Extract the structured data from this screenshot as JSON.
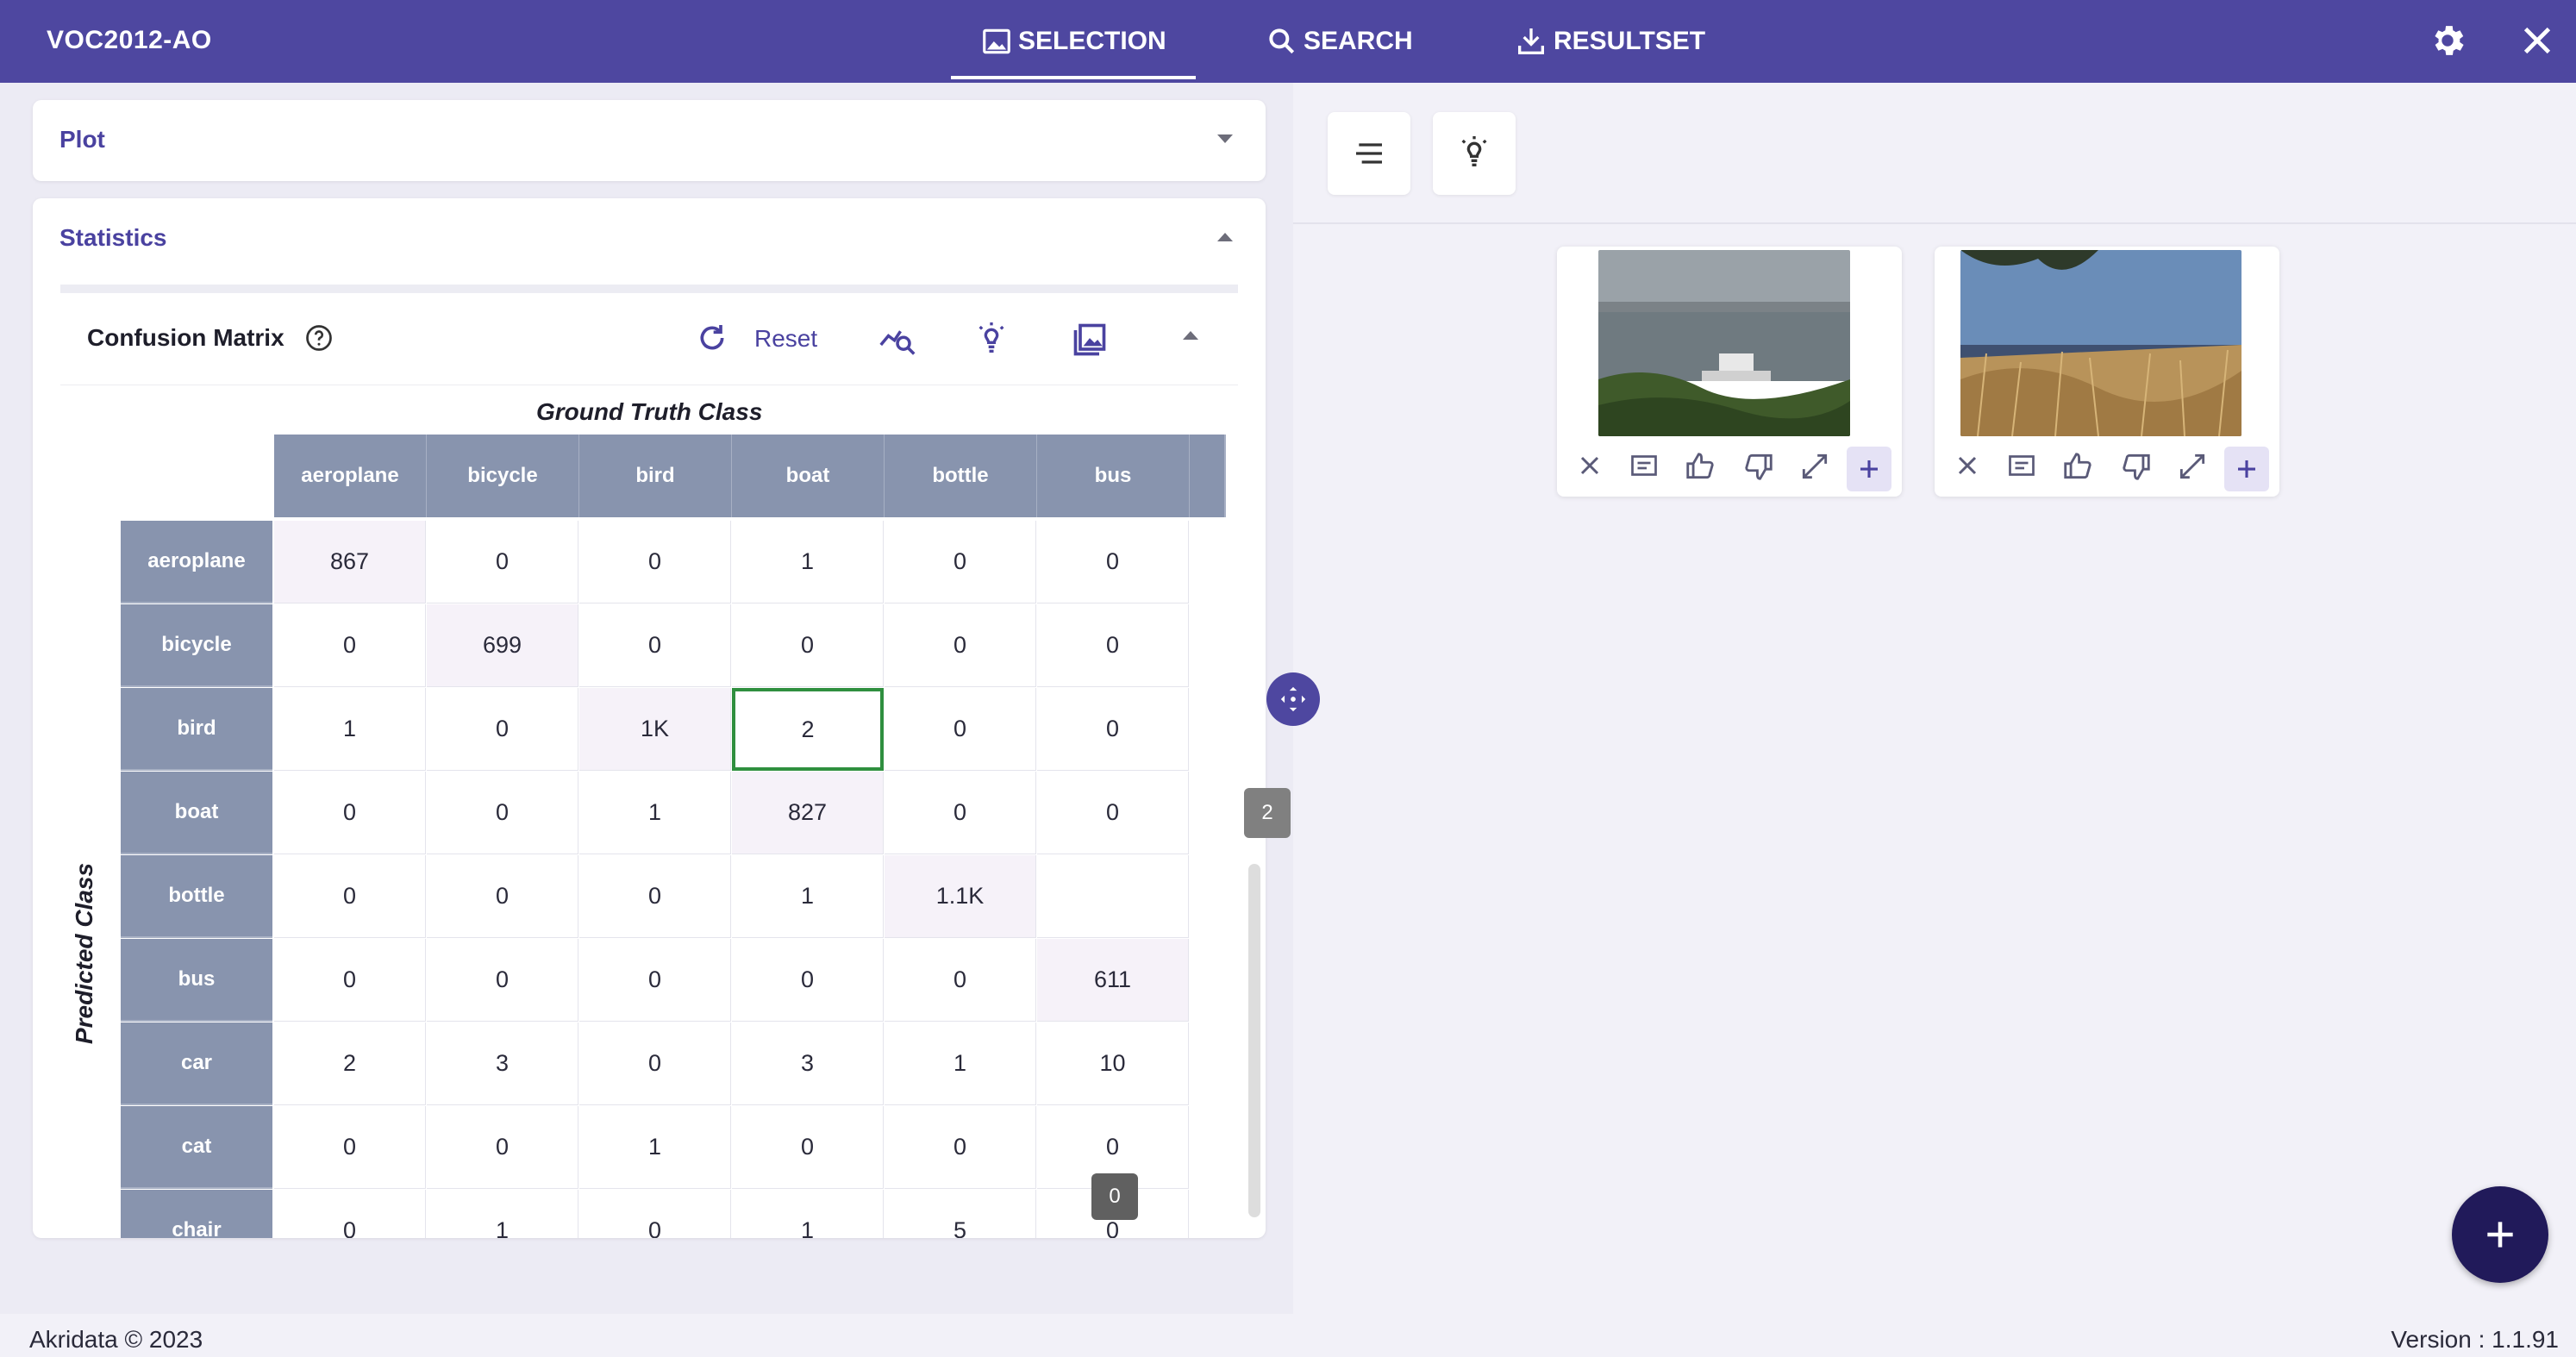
{
  "header": {
    "app_title": "VOC2012-AO",
    "tabs": [
      {
        "label": "SELECTION",
        "icon": "image-icon",
        "active": true
      },
      {
        "label": "SEARCH",
        "icon": "search-icon",
        "active": false
      },
      {
        "label": "RESULTSET",
        "icon": "download-icon",
        "active": false
      }
    ],
    "accent_color": "#4e47a0"
  },
  "left_panel": {
    "plot_title": "Plot",
    "statistics_title": "Statistics",
    "confusion_matrix": {
      "title": "Confusion Matrix",
      "reset_label": "Reset",
      "ground_truth_label": "Ground Truth Class",
      "predicted_label": "Predicted Class",
      "columns": [
        "aeroplane",
        "bicycle",
        "bird",
        "boat",
        "bottle",
        "bus"
      ],
      "rows": [
        {
          "label": "aeroplane",
          "values": [
            "867",
            "0",
            "0",
            "1",
            "0",
            "0"
          ]
        },
        {
          "label": "bicycle",
          "values": [
            "0",
            "699",
            "0",
            "0",
            "0",
            "0"
          ]
        },
        {
          "label": "bird",
          "values": [
            "1",
            "0",
            "1K",
            "2",
            "0",
            "0"
          ]
        },
        {
          "label": "boat",
          "values": [
            "0",
            "0",
            "1",
            "827",
            "0",
            "0"
          ]
        },
        {
          "label": "bottle",
          "values": [
            "0",
            "0",
            "0",
            "1",
            "1.1K",
            ""
          ]
        },
        {
          "label": "bus",
          "values": [
            "0",
            "0",
            "0",
            "0",
            "0",
            "611"
          ]
        },
        {
          "label": "car",
          "values": [
            "2",
            "3",
            "0",
            "3",
            "1",
            "10"
          ]
        },
        {
          "label": "cat",
          "values": [
            "0",
            "0",
            "1",
            "0",
            "0",
            "0"
          ]
        },
        {
          "label": "chair",
          "values": [
            "0",
            "1",
            "0",
            "1",
            "5",
            "0"
          ]
        }
      ],
      "selected_cell": {
        "row": "bird",
        "column": "boat"
      },
      "hover_tooltip": "0",
      "scroll_badge": "2"
    }
  },
  "right_panel": {
    "toolbar_icons": [
      "list-icon",
      "lightbulb-icon"
    ],
    "results": [
      {
        "name": "result-card-1"
      },
      {
        "name": "result-card-2"
      }
    ]
  },
  "footer": {
    "copyright": "Akridata © 2023",
    "version": "Version : 1.1.91"
  }
}
